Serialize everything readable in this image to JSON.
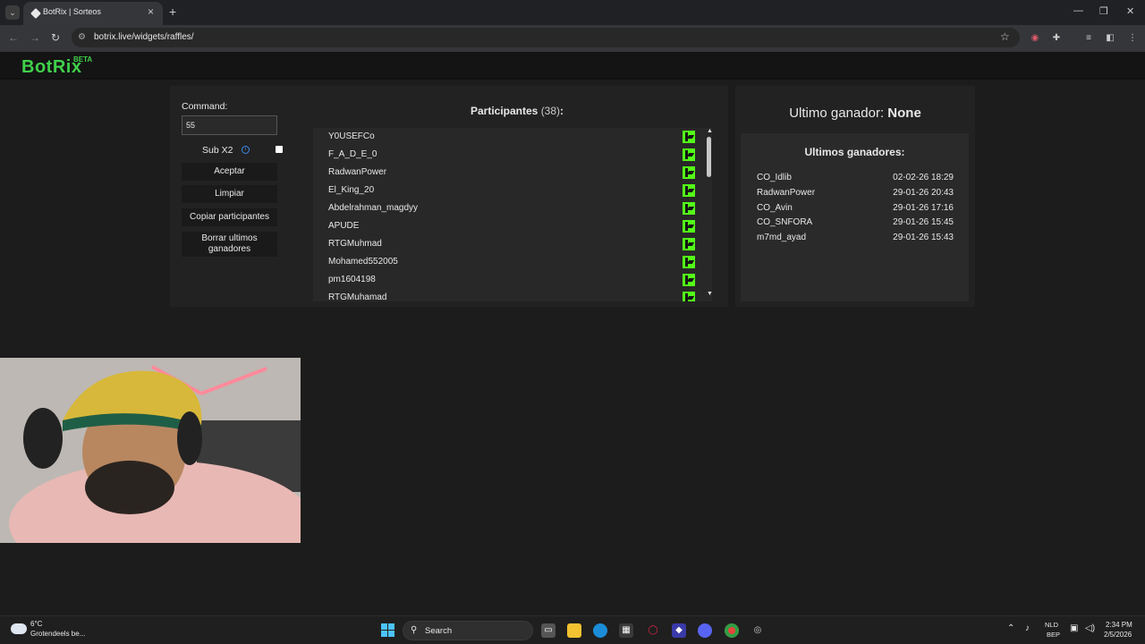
{
  "browser": {
    "tab_title": "BotRix | Sorteos",
    "url": "botrix.live/widgets/raffles/"
  },
  "site": {
    "logo": "BotRix",
    "logo_badge": "BETA",
    "brand_color": "#3fd14a"
  },
  "raffle": {
    "command_label": "Command:",
    "command_value": "55",
    "sub_x2_label": "Sub X2",
    "sub_x2_checked": false,
    "buttons": {
      "accept": "Aceptar",
      "clear": "Limpiar",
      "copy": "Copiar participantes",
      "delete": "Borrar ultimos ganadores"
    },
    "participants_title": "Participantes",
    "participants_count": "(38)",
    "participants_colon": ":",
    "participants": [
      "Y0USEFCo",
      "F_A_D_E_0",
      "RadwanPower",
      "El_King_20",
      "Abdelrahman_magdyy",
      "APUDE",
      "RTGMuhmad",
      "Mohamed552005",
      "pm1604198",
      "RTGMuhamad"
    ],
    "platform_icon": "kick-icon",
    "platform_color": "#53fc18"
  },
  "winners": {
    "last_winner_label": "Ultimo ganador:",
    "last_winner_value": "None",
    "list_title": "Ultimos ganadores:",
    "list": [
      {
        "name": "CO_Idlib",
        "date": "02-02-26 18:29"
      },
      {
        "name": "RadwanPower",
        "date": "29-01-26 20:43"
      },
      {
        "name": "CO_Avin",
        "date": "29-01-26 17:16"
      },
      {
        "name": "CO_SNFORA",
        "date": "29-01-26 15:45"
      },
      {
        "name": "m7md_ayad",
        "date": "29-01-26 15:43"
      }
    ]
  },
  "taskbar": {
    "weather_temp": "6°C",
    "weather_desc": "Grotendeels be...",
    "search_label": "Search",
    "lang1": "NLD",
    "lang2": "BEP",
    "time": "2:34 PM",
    "date": "2/5/2026"
  }
}
